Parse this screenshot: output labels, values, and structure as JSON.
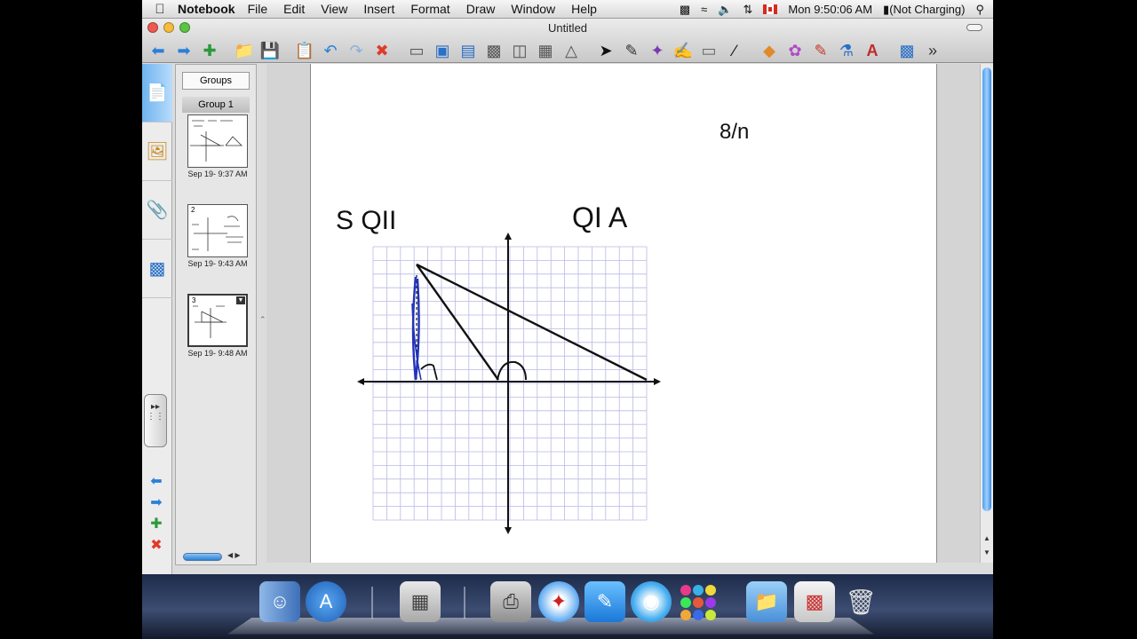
{
  "menubar": {
    "app_name": "Notebook",
    "menus": [
      "File",
      "Edit",
      "View",
      "Insert",
      "Format",
      "Draw",
      "Window",
      "Help"
    ],
    "clock": "Mon 9:50:06 AM",
    "battery": "(Not Charging)"
  },
  "window": {
    "title": "Untitled"
  },
  "sorter": {
    "groups_button": "Groups",
    "group_name": "Group 1",
    "pages": [
      {
        "number": "",
        "timestamp": "Sep 19- 9:37 AM"
      },
      {
        "number": "2",
        "timestamp": "Sep 19- 9:43 AM"
      },
      {
        "number": "3",
        "timestamp": "Sep 19- 9:48 AM"
      }
    ]
  },
  "canvas": {
    "handwriting": {
      "quadrant_ii": "S QII",
      "quadrant_i": "QI A",
      "top_note": "8/n"
    }
  },
  "colors": {
    "grid_line": "#b9b9e6",
    "ink": "#111111",
    "blue_ink": "#2233bb",
    "tab_active": "#6fb3ef"
  }
}
